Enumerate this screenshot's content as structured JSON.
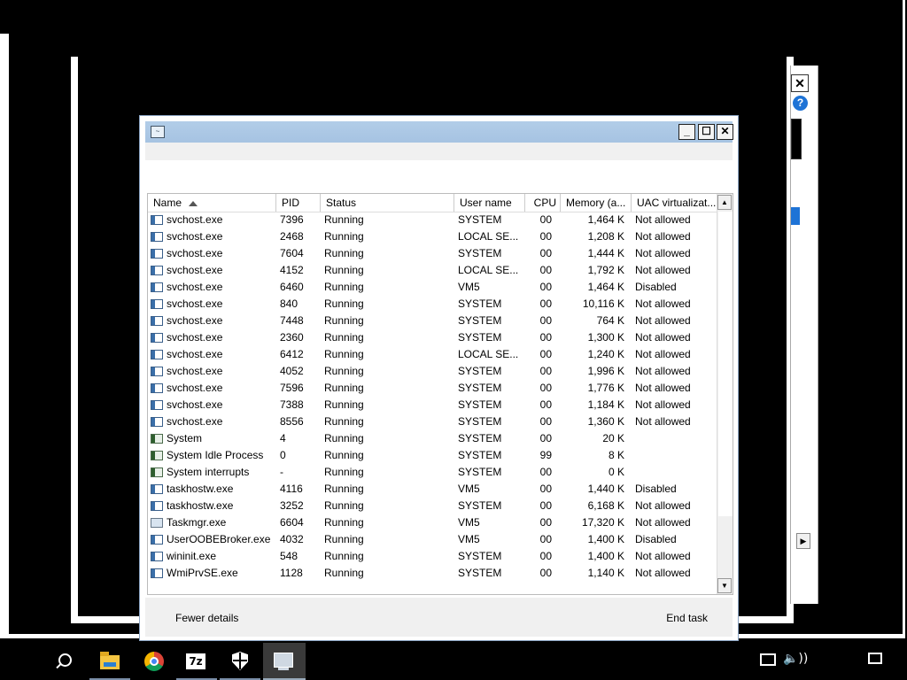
{
  "background_dialog": {
    "close_label": "✕",
    "help_label": "?",
    "scroll_right_label": "▶"
  },
  "window": {
    "minimize_label": "_",
    "maximize_label": "☐",
    "close_label": "✕",
    "icon": "task-manager-icon"
  },
  "columns": {
    "name": "Name",
    "pid": "PID",
    "status": "Status",
    "user": "User name",
    "cpu": "CPU",
    "memory": "Memory (a...",
    "uac": "UAC virtualizat..."
  },
  "rows": [
    {
      "name": "svchost.exe",
      "pid": "7396",
      "status": "Running",
      "user": "SYSTEM",
      "cpu": "00",
      "mem": "1,464 K",
      "uac": "Not allowed"
    },
    {
      "name": "svchost.exe",
      "pid": "2468",
      "status": "Running",
      "user": "LOCAL SE...",
      "cpu": "00",
      "mem": "1,208 K",
      "uac": "Not allowed"
    },
    {
      "name": "svchost.exe",
      "pid": "7604",
      "status": "Running",
      "user": "SYSTEM",
      "cpu": "00",
      "mem": "1,444 K",
      "uac": "Not allowed"
    },
    {
      "name": "svchost.exe",
      "pid": "4152",
      "status": "Running",
      "user": "LOCAL SE...",
      "cpu": "00",
      "mem": "1,792 K",
      "uac": "Not allowed"
    },
    {
      "name": "svchost.exe",
      "pid": "6460",
      "status": "Running",
      "user": "VM5",
      "cpu": "00",
      "mem": "1,464 K",
      "uac": "Disabled"
    },
    {
      "name": "svchost.exe",
      "pid": "840",
      "status": "Running",
      "user": "SYSTEM",
      "cpu": "00",
      "mem": "10,116 K",
      "uac": "Not allowed"
    },
    {
      "name": "svchost.exe",
      "pid": "7448",
      "status": "Running",
      "user": "SYSTEM",
      "cpu": "00",
      "mem": "764 K",
      "uac": "Not allowed"
    },
    {
      "name": "svchost.exe",
      "pid": "2360",
      "status": "Running",
      "user": "SYSTEM",
      "cpu": "00",
      "mem": "1,300 K",
      "uac": "Not allowed"
    },
    {
      "name": "svchost.exe",
      "pid": "6412",
      "status": "Running",
      "user": "LOCAL SE...",
      "cpu": "00",
      "mem": "1,240 K",
      "uac": "Not allowed"
    },
    {
      "name": "svchost.exe",
      "pid": "4052",
      "status": "Running",
      "user": "SYSTEM",
      "cpu": "00",
      "mem": "1,996 K",
      "uac": "Not allowed"
    },
    {
      "name": "svchost.exe",
      "pid": "7596",
      "status": "Running",
      "user": "SYSTEM",
      "cpu": "00",
      "mem": "1,776 K",
      "uac": "Not allowed"
    },
    {
      "name": "svchost.exe",
      "pid": "7388",
      "status": "Running",
      "user": "SYSTEM",
      "cpu": "00",
      "mem": "1,184 K",
      "uac": "Not allowed"
    },
    {
      "name": "svchost.exe",
      "pid": "8556",
      "status": "Running",
      "user": "SYSTEM",
      "cpu": "00",
      "mem": "1,360 K",
      "uac": "Not allowed"
    },
    {
      "name": "System",
      "pid": "4",
      "status": "Running",
      "user": "SYSTEM",
      "cpu": "00",
      "mem": "20 K",
      "uac": ""
    },
    {
      "name": "System Idle Process",
      "pid": "0",
      "status": "Running",
      "user": "SYSTEM",
      "cpu": "99",
      "mem": "8 K",
      "uac": ""
    },
    {
      "name": "System interrupts",
      "pid": "-",
      "status": "Running",
      "user": "SYSTEM",
      "cpu": "00",
      "mem": "0 K",
      "uac": ""
    },
    {
      "name": "taskhostw.exe",
      "pid": "4116",
      "status": "Running",
      "user": "VM5",
      "cpu": "00",
      "mem": "1,440 K",
      "uac": "Disabled"
    },
    {
      "name": "taskhostw.exe",
      "pid": "3252",
      "status": "Running",
      "user": "SYSTEM",
      "cpu": "00",
      "mem": "6,168 K",
      "uac": "Not allowed"
    },
    {
      "name": "Taskmgr.exe",
      "pid": "6604",
      "status": "Running",
      "user": "VM5",
      "cpu": "00",
      "mem": "17,320 K",
      "uac": "Not allowed"
    },
    {
      "name": "UserOOBEBroker.exe",
      "pid": "4032",
      "status": "Running",
      "user": "VM5",
      "cpu": "00",
      "mem": "1,400 K",
      "uac": "Disabled"
    },
    {
      "name": "wininit.exe",
      "pid": "548",
      "status": "Running",
      "user": "SYSTEM",
      "cpu": "00",
      "mem": "1,400 K",
      "uac": "Not allowed"
    },
    {
      "name": "WmiPrvSE.exe",
      "pid": "1128",
      "status": "Running",
      "user": "SYSTEM",
      "cpu": "00",
      "mem": "1,140 K",
      "uac": "Not allowed"
    }
  ],
  "footer": {
    "fewer_details": "Fewer details",
    "end_task": "End task"
  },
  "taskbar": {
    "items": [
      "search-icon",
      "file-explorer-icon",
      "chrome-icon",
      "7zip-icon",
      "security-shield-icon",
      "task-manager-icon"
    ],
    "seven_zip_label": "7z",
    "volume_glyph": "🔈))"
  }
}
